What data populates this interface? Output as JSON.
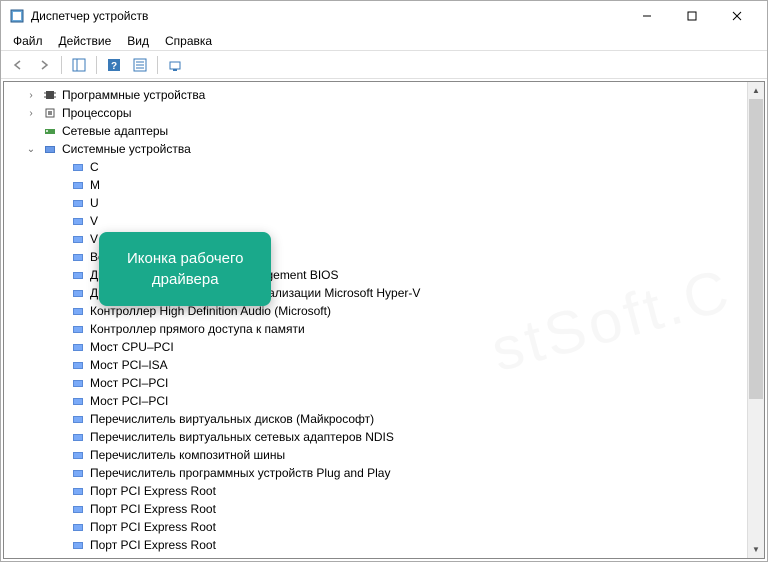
{
  "window": {
    "title": "Диспетчер устройств"
  },
  "menu": {
    "file": "Файл",
    "action": "Действие",
    "view": "Вид",
    "help": "Справка"
  },
  "tree": {
    "categories": [
      {
        "label": "Программные устройства",
        "icon": "chip",
        "expanded": false
      },
      {
        "label": "Процессоры",
        "icon": "cpu",
        "expanded": false
      },
      {
        "label": "Сетевые адаптеры",
        "icon": "network",
        "expanded": false,
        "noexpander": true
      },
      {
        "label": "Системные устройства",
        "icon": "system",
        "expanded": true
      }
    ],
    "system_children": [
      "C",
      "M",
      "U",
      "V",
      "V",
      "Встроенный динамик",
      "Драйвер Microsoft System Management BIOS",
      "Драйвер инфраструктуры виртуализации Microsoft Hyper-V",
      "Контроллер High Definition Audio (Microsoft)",
      "Контроллер прямого доступа к памяти",
      "Мост CPU–PCI",
      "Мост PCI–ISA",
      "Мост PCI–PCI",
      "Мост PCI–PCI",
      "Перечислитель виртуальных дисков (Майкрософт)",
      "Перечислитель виртуальных сетевых адаптеров NDIS",
      "Перечислитель композитной шины",
      "Перечислитель программных устройств Plug and Play",
      "Порт PCI Express Root",
      "Порт PCI Express Root",
      "Порт PCI Express Root",
      "Порт PCI Express Root"
    ]
  },
  "callout": {
    "line1": "Иконка рабочего",
    "line2": "драйвера"
  },
  "watermark": "stSoft.C"
}
